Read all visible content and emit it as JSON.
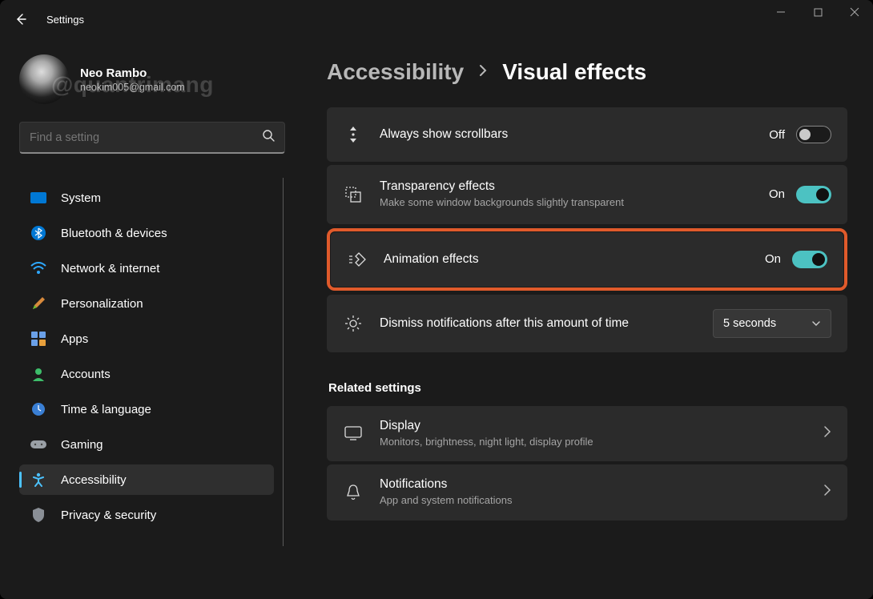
{
  "titlebar": {
    "title": "Settings"
  },
  "profile": {
    "name": "Neo Rambo",
    "email": "neokim005@gmail.com",
    "watermark": "@quantrimang"
  },
  "search": {
    "placeholder": "Find a setting"
  },
  "nav": {
    "items": [
      {
        "label": "System"
      },
      {
        "label": "Bluetooth & devices"
      },
      {
        "label": "Network & internet"
      },
      {
        "label": "Personalization"
      },
      {
        "label": "Apps"
      },
      {
        "label": "Accounts"
      },
      {
        "label": "Time & language"
      },
      {
        "label": "Gaming"
      },
      {
        "label": "Accessibility"
      },
      {
        "label": "Privacy & security"
      }
    ]
  },
  "breadcrumb": {
    "parent": "Accessibility",
    "current": "Visual effects"
  },
  "settings": {
    "scrollbars": {
      "title": "Always show scrollbars",
      "state_label": "Off",
      "state": "off"
    },
    "transparency": {
      "title": "Transparency effects",
      "subtitle": "Make some window backgrounds slightly transparent",
      "state_label": "On",
      "state": "on"
    },
    "animation": {
      "title": "Animation effects",
      "state_label": "On",
      "state": "on"
    },
    "dismiss": {
      "title": "Dismiss notifications after this amount of time",
      "value": "5 seconds"
    }
  },
  "related": {
    "heading": "Related settings",
    "display": {
      "title": "Display",
      "subtitle": "Monitors, brightness, night light, display profile"
    },
    "notifications": {
      "title": "Notifications",
      "subtitle": "App and system notifications"
    }
  }
}
